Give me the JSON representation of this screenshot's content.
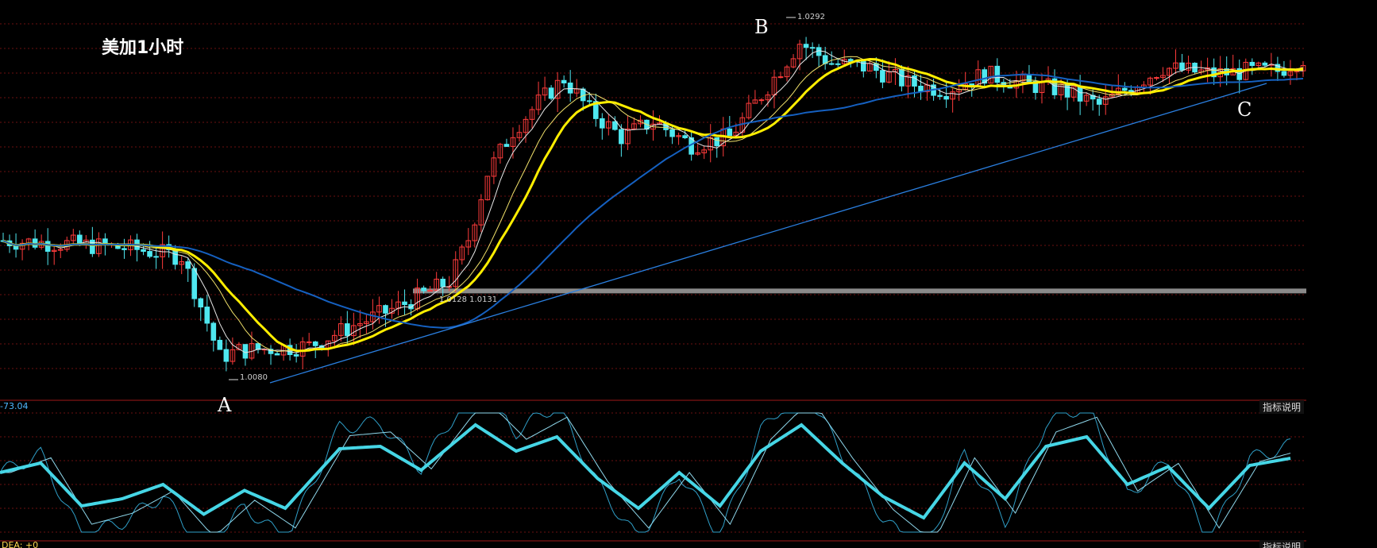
{
  "title": "美加1小时",
  "points": {
    "a": "A",
    "b": "B",
    "c": "C"
  },
  "price_labels": {
    "low": "1.0080",
    "high": "1.0292",
    "mid": "1.0128  1.0131"
  },
  "osc_label": "-73.04",
  "dea_label": "DEA: +0",
  "buttons": {
    "indicator_help_1": "指标说明",
    "indicator_help_2": "指标说明"
  },
  "colors": {
    "bull": "#ff3b3b",
    "bear": "#4fe8f0",
    "ma_thick": "#ffee00",
    "ma_long": "#1560c0",
    "trend": "#2a7fe0",
    "osc": "#46d6e6"
  },
  "chart_data": [
    {
      "type": "candlestick",
      "title": "美加1小时",
      "instrument": "USD/CAD",
      "timeframe": "1 hour",
      "ylim": [
        1.0065,
        1.0305
      ],
      "annotations": [
        {
          "label": "A",
          "price": 1.008
        },
        {
          "label": "B",
          "price": 1.0292
        },
        {
          "label": "C"
        }
      ],
      "horizontal_level": 1.013,
      "close_path": [
        [
          0,
          1.0162
        ],
        [
          10,
          1.016
        ],
        [
          20,
          1.0157
        ],
        [
          28,
          1.0152
        ],
        [
          32,
          1.011
        ],
        [
          34,
          1.0088
        ],
        [
          37,
          1.0092
        ],
        [
          48,
          1.0095
        ],
        [
          55,
          1.0108
        ],
        [
          62,
          1.012
        ],
        [
          70,
          1.0136
        ],
        [
          73,
          1.0163
        ],
        [
          76,
          1.0205
        ],
        [
          80,
          1.0232
        ],
        [
          84,
          1.025
        ],
        [
          88,
          1.0265
        ],
        [
          92,
          1.0245
        ],
        [
          97,
          1.0228
        ],
        [
          102,
          1.0238
        ],
        [
          108,
          1.0223
        ],
        [
          114,
          1.0228
        ],
        [
          120,
          1.026
        ],
        [
          125,
          1.0288
        ],
        [
          130,
          1.0275
        ],
        [
          136,
          1.0272
        ],
        [
          142,
          1.0262
        ],
        [
          148,
          1.0258
        ],
        [
          154,
          1.0268
        ],
        [
          160,
          1.0262
        ],
        [
          166,
          1.0258
        ],
        [
          172,
          1.0248
        ],
        [
          176,
          1.0258
        ],
        [
          182,
          1.0272
        ],
        [
          190,
          1.0268
        ],
        [
          196,
          1.027
        ],
        [
          200,
          1.027
        ],
        [
          204,
          1.0278
        ]
      ],
      "moving_average_period_lines": 4,
      "trendline": {
        "from": "A",
        "to": "C"
      }
    },
    {
      "type": "line",
      "panel": "oscillator",
      "value_label": "-73.04",
      "main_series": [
        [
          0,
          0.5
        ],
        [
          6,
          0.58
        ],
        [
          12,
          0.22
        ],
        [
          18,
          0.28
        ],
        [
          24,
          0.4
        ],
        [
          30,
          0.15
        ],
        [
          36,
          0.35
        ],
        [
          42,
          0.2
        ],
        [
          50,
          0.7
        ],
        [
          56,
          0.72
        ],
        [
          62,
          0.52
        ],
        [
          70,
          0.9
        ],
        [
          76,
          0.68
        ],
        [
          82,
          0.8
        ],
        [
          88,
          0.45
        ],
        [
          94,
          0.2
        ],
        [
          100,
          0.5
        ],
        [
          106,
          0.22
        ],
        [
          112,
          0.68
        ],
        [
          118,
          0.9
        ],
        [
          124,
          0.58
        ],
        [
          130,
          0.3
        ],
        [
          136,
          0.12
        ],
        [
          142,
          0.58
        ],
        [
          148,
          0.28
        ],
        [
          154,
          0.72
        ],
        [
          160,
          0.8
        ],
        [
          166,
          0.4
        ],
        [
          172,
          0.55
        ],
        [
          178,
          0.2
        ],
        [
          184,
          0.56
        ],
        [
          190,
          0.62
        ]
      ]
    }
  ]
}
